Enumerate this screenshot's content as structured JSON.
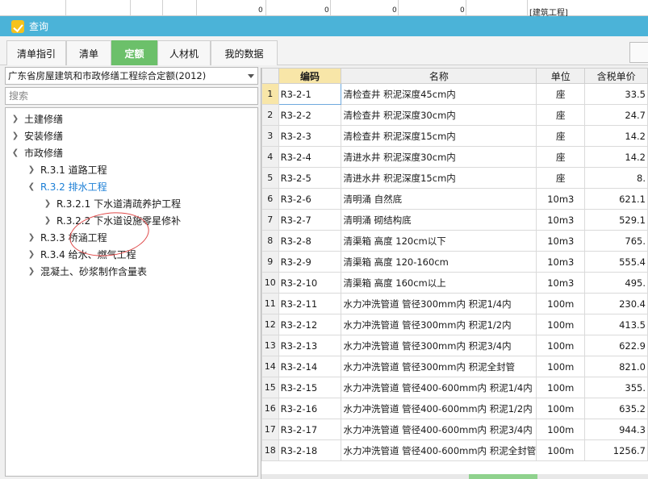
{
  "background": {
    "numbers": [
      "0",
      "0",
      "0",
      "0"
    ],
    "text": "[建筑工程]"
  },
  "window": {
    "title": "查询"
  },
  "tabs": [
    {
      "label": "清单指引",
      "active": false
    },
    {
      "label": "清单",
      "active": false
    },
    {
      "label": "定额",
      "active": true
    },
    {
      "label": "人材机",
      "active": false
    },
    {
      "label": "我的数据",
      "active": false
    }
  ],
  "left": {
    "combo_value": "广东省房屋建筑和市政修缮工程综合定额(2012)",
    "search_placeholder": "搜索",
    "tree": [
      {
        "label": "土建修缮",
        "expanded": false,
        "level": 0,
        "selected": false
      },
      {
        "label": "安装修缮",
        "expanded": false,
        "level": 0,
        "selected": false
      },
      {
        "label": "市政修缮",
        "expanded": true,
        "level": 0,
        "selected": false
      },
      {
        "label": "R.3.1 道路工程",
        "expanded": false,
        "level": 1,
        "selected": false
      },
      {
        "label": "R.3.2 排水工程",
        "expanded": true,
        "level": 1,
        "selected": true
      },
      {
        "label": "R.3.2.1 下水道清疏养护工程",
        "expanded": false,
        "level": 2,
        "selected": false
      },
      {
        "label": "R.3.2.2 下水道设施零星修补",
        "expanded": false,
        "level": 2,
        "selected": false
      },
      {
        "label": "R.3.3 桥涵工程",
        "expanded": false,
        "level": 1,
        "selected": false
      },
      {
        "label": "R.3.4 给水、燃气工程",
        "expanded": false,
        "level": 1,
        "selected": false
      },
      {
        "label": "混凝土、砂浆制作含量表",
        "expanded": false,
        "level": 1,
        "selected": false
      }
    ]
  },
  "grid": {
    "headers": {
      "code": "编码",
      "name": "名称",
      "unit": "单位",
      "price": "含税单价"
    },
    "rows": [
      {
        "idx": "1",
        "code": "R3-2-1",
        "name": "清检查井 积泥深度45cm内",
        "unit": "座",
        "price": "33.5"
      },
      {
        "idx": "2",
        "code": "R3-2-2",
        "name": "清检查井 积泥深度30cm内",
        "unit": "座",
        "price": "24.7"
      },
      {
        "idx": "3",
        "code": "R3-2-3",
        "name": "清检查井 积泥深度15cm内",
        "unit": "座",
        "price": "14.2"
      },
      {
        "idx": "4",
        "code": "R3-2-4",
        "name": "清进水井 积泥深度30cm内",
        "unit": "座",
        "price": "14.2"
      },
      {
        "idx": "5",
        "code": "R3-2-5",
        "name": "清进水井 积泥深度15cm内",
        "unit": "座",
        "price": "8."
      },
      {
        "idx": "6",
        "code": "R3-2-6",
        "name": "清明涌 自然底",
        "unit": "10m3",
        "price": "621.1"
      },
      {
        "idx": "7",
        "code": "R3-2-7",
        "name": "清明涌 砌结构底",
        "unit": "10m3",
        "price": "529.1"
      },
      {
        "idx": "8",
        "code": "R3-2-8",
        "name": "清渠箱 高度 120cm以下",
        "unit": "10m3",
        "price": "765."
      },
      {
        "idx": "9",
        "code": "R3-2-9",
        "name": "清渠箱 高度 120-160cm",
        "unit": "10m3",
        "price": "555.4"
      },
      {
        "idx": "10",
        "code": "R3-2-10",
        "name": "清渠箱 高度 160cm以上",
        "unit": "10m3",
        "price": "495."
      },
      {
        "idx": "11",
        "code": "R3-2-11",
        "name": "水力冲洗管道 管径300mm内 积泥1/4内",
        "unit": "100m",
        "price": "230.4"
      },
      {
        "idx": "12",
        "code": "R3-2-12",
        "name": "水力冲洗管道 管径300mm内 积泥1/2内",
        "unit": "100m",
        "price": "413.5"
      },
      {
        "idx": "13",
        "code": "R3-2-13",
        "name": "水力冲洗管道 管径300mm内 积泥3/4内",
        "unit": "100m",
        "price": "622.9"
      },
      {
        "idx": "14",
        "code": "R3-2-14",
        "name": "水力冲洗管道 管径300mm内 积泥全封管",
        "unit": "100m",
        "price": "821.0"
      },
      {
        "idx": "15",
        "code": "R3-2-15",
        "name": "水力冲洗管道 管径400-600mm内 积泥1/4内",
        "unit": "100m",
        "price": "355."
      },
      {
        "idx": "16",
        "code": "R3-2-16",
        "name": "水力冲洗管道 管径400-600mm内 积泥1/2内",
        "unit": "100m",
        "price": "635.2"
      },
      {
        "idx": "17",
        "code": "R3-2-17",
        "name": "水力冲洗管道 管径400-600mm内 积泥3/4内",
        "unit": "100m",
        "price": "944.3"
      },
      {
        "idx": "18",
        "code": "R3-2-18",
        "name": "水力冲洗管道 管径400-600mm内 积泥全封管",
        "unit": "100m",
        "price": "1256.7"
      }
    ]
  }
}
